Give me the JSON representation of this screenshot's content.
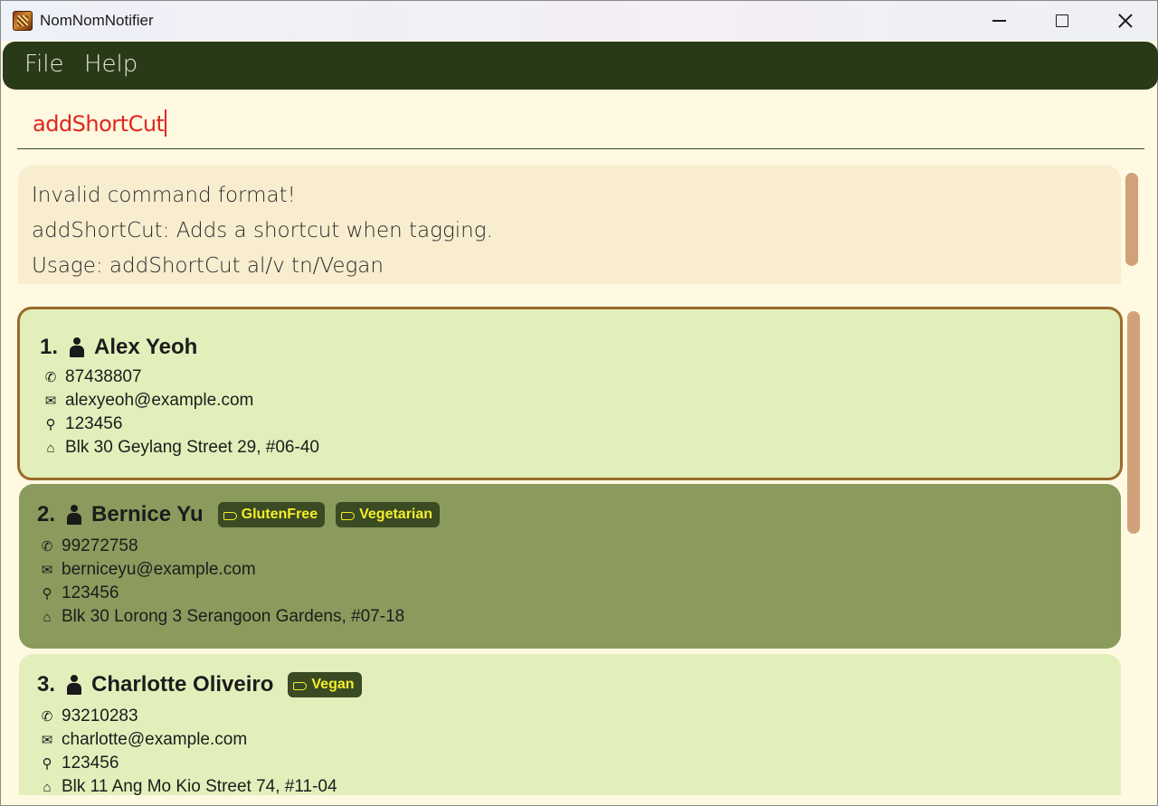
{
  "window": {
    "title": "NomNomNotifier",
    "icon": "app-logo-icon"
  },
  "menu": {
    "file_label": "File",
    "help_label": "Help"
  },
  "command": {
    "value": "addShortCut",
    "text_color": "#e0261e"
  },
  "result": {
    "lines": [
      "Invalid command format!",
      "addShortCut: Adds a shortcut when tagging.",
      "Usage: addShortCut al/v tn/Vegan"
    ]
  },
  "colors": {
    "menubar": "#293a18",
    "card_light": "#e2efbb",
    "card_dark": "#8b9b5d",
    "tag_bg": "#3a4a22",
    "tag_text": "#f4ee2a",
    "scrollbar": "#d1a27a",
    "selected_border": "#9a6a2a"
  },
  "persons": [
    {
      "index": "1.",
      "name": "Alex Yeoh",
      "tags": [],
      "phone": "87438807",
      "email": "alexyeoh@example.com",
      "postal": "123456",
      "address": "Blk 30 Geylang Street 29, #06-40",
      "selected": true
    },
    {
      "index": "2.",
      "name": "Bernice Yu",
      "tags": [
        "GlutenFree",
        "Vegetarian"
      ],
      "phone": "99272758",
      "email": "berniceyu@example.com",
      "postal": "123456",
      "address": "Blk 30 Lorong 3 Serangoon Gardens, #07-18",
      "selected": false
    },
    {
      "index": "3.",
      "name": "Charlotte Oliveiro",
      "tags": [
        "Vegan"
      ],
      "phone": "93210283",
      "email": "charlotte@example.com",
      "postal": "123456",
      "address": "Blk 11 Ang Mo Kio Street 74, #11-04",
      "selected": false
    }
  ]
}
